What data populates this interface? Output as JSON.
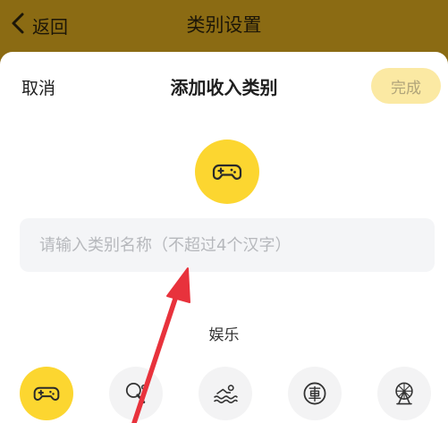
{
  "navbar": {
    "back_label": "返回",
    "title": "类别设置"
  },
  "sheet": {
    "cancel_label": "取消",
    "title": "添加收入类别",
    "done_label": "完成",
    "selected_icon": "gamepad-icon",
    "input": {
      "placeholder": "请输入类别名称（不超过4个汉字）",
      "value": ""
    },
    "section_label": "娱乐",
    "icons": [
      {
        "name": "gamepad-icon",
        "selected": true
      },
      {
        "name": "table-tennis-icon",
        "selected": false
      },
      {
        "name": "swimming-icon",
        "selected": false
      },
      {
        "name": "car-character-icon",
        "selected": false
      },
      {
        "name": "ferris-wheel-icon",
        "selected": false
      }
    ]
  },
  "colors": {
    "navbar": "#8b6b13",
    "accent": "#fcd630",
    "done_bg": "#fbe9a3",
    "input_bg": "#f4f5f7",
    "arrow": "#e8323c"
  }
}
